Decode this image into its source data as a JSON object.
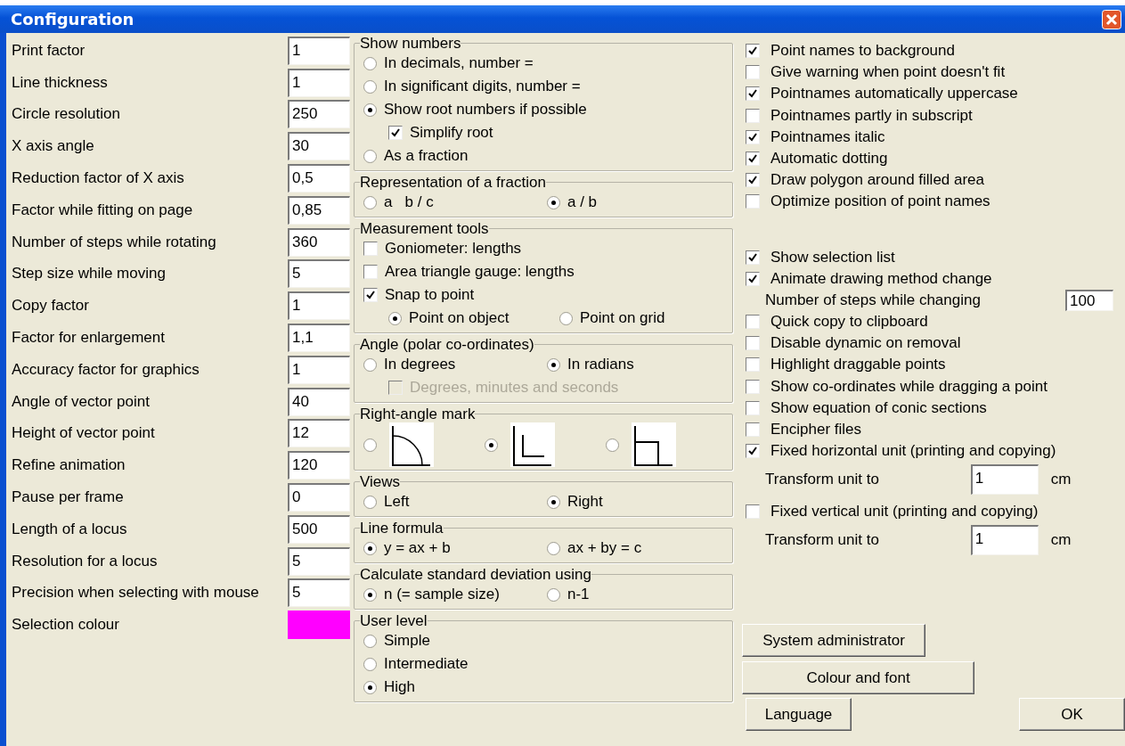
{
  "window": {
    "title": "Configuration"
  },
  "settings": [
    {
      "label": "Print factor",
      "value": "1"
    },
    {
      "label": "Line thickness",
      "value": "1"
    },
    {
      "label": "Circle resolution",
      "value": "250"
    },
    {
      "label": "X axis angle",
      "value": "30"
    },
    {
      "label": "Reduction factor of X axis",
      "value": "0,5"
    },
    {
      "label": "Factor while fitting on page",
      "value": "0,85"
    },
    {
      "label": "Number of steps while rotating",
      "value": "360"
    },
    {
      "label": "Step size while moving",
      "value": "5"
    },
    {
      "label": "Copy factor",
      "value": "1"
    },
    {
      "label": "Factor for enlargement",
      "value": "1,1"
    },
    {
      "label": "Accuracy factor for graphics",
      "value": "1"
    },
    {
      "label": "Angle of vector point",
      "value": "40"
    },
    {
      "label": "Height of vector point",
      "value": "12"
    },
    {
      "label": "Refine animation",
      "value": "120"
    },
    {
      "label": "Pause per frame",
      "value": "0"
    },
    {
      "label": "Length of a locus",
      "value": "500"
    },
    {
      "label": "Resolution for a locus",
      "value": "5"
    },
    {
      "label": "Precision when selecting with mouse",
      "value": "5"
    },
    {
      "label": "Selection colour",
      "kind": "colour",
      "color": "#ff00ff"
    }
  ],
  "groups": [
    {
      "title": "Show numbers",
      "rows": [
        {
          "items": [
            {
              "kind": "radio",
              "label": "In decimals, number =",
              "selected": false
            }
          ]
        },
        {
          "items": [
            {
              "kind": "radio",
              "label": "In significant digits, number =",
              "selected": false
            }
          ]
        },
        {
          "items": [
            {
              "kind": "radio",
              "label": "Show root numbers if possible",
              "selected": true
            }
          ],
          "children": [
            {
              "items": [
                {
                  "kind": "checkbox",
                  "label": "Simplify root",
                  "checked": true
                }
              ]
            }
          ]
        },
        {
          "items": [
            {
              "kind": "radio",
              "label": "As a fraction",
              "selected": false
            }
          ]
        }
      ]
    },
    {
      "title": "Representation of a fraction",
      "rows": [
        {
          "items": [
            {
              "kind": "radio",
              "label": "a   b / c",
              "selected": false
            },
            {
              "kind": "radio",
              "label": "a / b",
              "selected": true
            }
          ]
        }
      ]
    },
    {
      "title": "Measurement tools",
      "rows": [
        {
          "items": [
            {
              "kind": "checkbox",
              "label": "Goniometer: lengths",
              "checked": false
            }
          ]
        },
        {
          "items": [
            {
              "kind": "checkbox",
              "label": "Area triangle gauge: lengths",
              "checked": false
            }
          ]
        },
        {
          "items": [
            {
              "kind": "checkbox",
              "label": "Snap to point",
              "checked": true
            }
          ],
          "children": [
            {
              "items": [
                {
                  "kind": "radio",
                  "label": "Point on object",
                  "selected": true
                },
                {
                  "kind": "radio",
                  "label": "Point on grid",
                  "selected": false
                }
              ]
            }
          ]
        }
      ]
    },
    {
      "title": "Angle (polar co-ordinates)",
      "rows": [
        {
          "items": [
            {
              "kind": "radio",
              "label": "In degrees",
              "selected": false
            },
            {
              "kind": "radio",
              "label": "In radians",
              "selected": true
            }
          ],
          "children": [
            {
              "items": [
                {
                  "kind": "checkbox",
                  "label": "Degrees, minutes and seconds",
                  "checked": false,
                  "disabled": true
                }
              ]
            }
          ]
        }
      ]
    },
    {
      "title": "Right-angle mark",
      "rows": [
        {
          "items": [
            {
              "kind": "arc-mark",
              "selected": false
            },
            {
              "kind": "corner-mark",
              "selected": true
            },
            {
              "kind": "square-mark",
              "selected": false
            }
          ]
        }
      ]
    },
    {
      "title": "Views",
      "rows": [
        {
          "items": [
            {
              "kind": "radio",
              "label": "Left",
              "selected": false
            },
            {
              "kind": "radio",
              "label": "Right",
              "selected": true
            }
          ]
        }
      ]
    },
    {
      "title": "Line formula",
      "rows": [
        {
          "items": [
            {
              "kind": "radio",
              "label": "y = ax + b",
              "selected": true
            },
            {
              "kind": "radio",
              "label": "ax + by = c",
              "selected": false
            }
          ]
        }
      ]
    },
    {
      "title": "Calculate standard deviation using",
      "rows": [
        {
          "items": [
            {
              "kind": "radio",
              "label": "n (= sample size)",
              "selected": true
            },
            {
              "kind": "radio",
              "label": "n-1",
              "selected": false
            }
          ]
        }
      ]
    },
    {
      "title": "User level",
      "rows": [
        {
          "items": [
            {
              "kind": "radio",
              "label": "Simple",
              "selected": false
            }
          ]
        },
        {
          "items": [
            {
              "kind": "radio",
              "label": "Intermediate",
              "selected": false
            }
          ]
        },
        {
          "items": [
            {
              "kind": "radio",
              "label": "High",
              "selected": true
            }
          ]
        }
      ]
    }
  ],
  "display_options": [
    {
      "label": "Point names to background",
      "checked": true
    },
    {
      "label": "Give warning when point doesn't fit",
      "checked": false
    },
    {
      "label": "Pointnames automatically uppercase",
      "checked": true
    },
    {
      "label": "Pointnames partly in subscript",
      "checked": false
    },
    {
      "label": "Pointnames italic",
      "checked": true
    },
    {
      "label": "Automatic dotting",
      "checked": true
    },
    {
      "label": "Draw polygon around filled area",
      "checked": true
    },
    {
      "label": "Optimize position of point names",
      "checked": false
    }
  ],
  "behaviour_options": [
    {
      "label": "Show selection list",
      "checked": true
    },
    {
      "label": "Animate drawing method change",
      "checked": true,
      "children": [
        {
          "label": "Number of steps while changing",
          "value": "100"
        }
      ]
    },
    {
      "label": "Quick copy to clipboard",
      "checked": false
    },
    {
      "label": "Disable dynamic on removal",
      "checked": false
    },
    {
      "label": "Highlight draggable points",
      "checked": false
    },
    {
      "label": "Show co-ordinates while dragging a point",
      "checked": false
    },
    {
      "label": "Show equation of conic sections",
      "checked": false
    },
    {
      "label": "Encipher files",
      "checked": false
    },
    {
      "label": "Fixed horizontal unit (printing and copying)",
      "checked": true,
      "children": [
        {
          "label": "Transform unit to",
          "value": "1",
          "unit": "cm"
        }
      ]
    },
    {
      "label": "Fixed vertical unit (printing and copying)",
      "checked": false,
      "children": [
        {
          "label": "Transform unit to",
          "value": "1",
          "unit": "cm"
        }
      ]
    }
  ],
  "buttons": [
    {
      "label": "System administrator"
    },
    {
      "label": "Colour and font"
    },
    {
      "label": "Language"
    },
    {
      "label": "OK"
    }
  ]
}
